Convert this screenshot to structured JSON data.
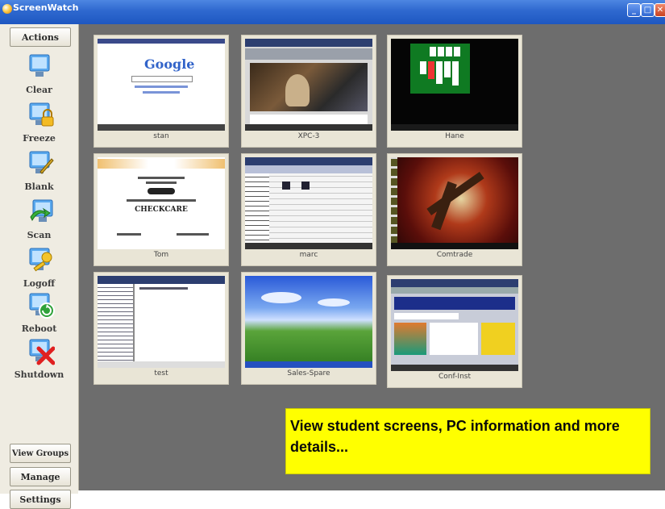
{
  "window": {
    "title": "ScreenWatch",
    "buttons": [
      "minimize",
      "maximize",
      "close"
    ]
  },
  "sidebar": {
    "actions_label": "Actions",
    "actions": [
      {
        "label": "Clear",
        "icon": "monitor-clear-icon"
      },
      {
        "label": "Freeze",
        "icon": "monitor-lock-icon"
      },
      {
        "label": "Blank",
        "icon": "monitor-blank-icon"
      },
      {
        "label": "Scan",
        "icon": "monitor-scan-icon"
      },
      {
        "label": "Logoff",
        "icon": "monitor-key-icon"
      },
      {
        "label": "Reboot",
        "icon": "monitor-reboot-icon"
      },
      {
        "label": "Shutdown",
        "icon": "monitor-shutdown-icon"
      }
    ],
    "bottom": {
      "view_groups": "View Groups",
      "manage": "Manage",
      "settings": "Settings"
    }
  },
  "thumbnails": [
    {
      "name": "stan",
      "content": "Google"
    },
    {
      "name": "XPC-3"
    },
    {
      "name": "Hane"
    },
    {
      "name": "Tom",
      "content": "CHECKCARE"
    },
    {
      "name": "marc"
    },
    {
      "name": "Comtrade"
    },
    {
      "name": "test"
    },
    {
      "name": "Sales-Spare"
    },
    {
      "name": "Conf-Inst"
    }
  ],
  "callout": {
    "text": "View student screens, PC information and more details..."
  },
  "colors": {
    "titlebar": "#2e68cf",
    "workspace": "#6d6d6d",
    "callout": "#ffff00",
    "sidebar": "#efece2"
  }
}
